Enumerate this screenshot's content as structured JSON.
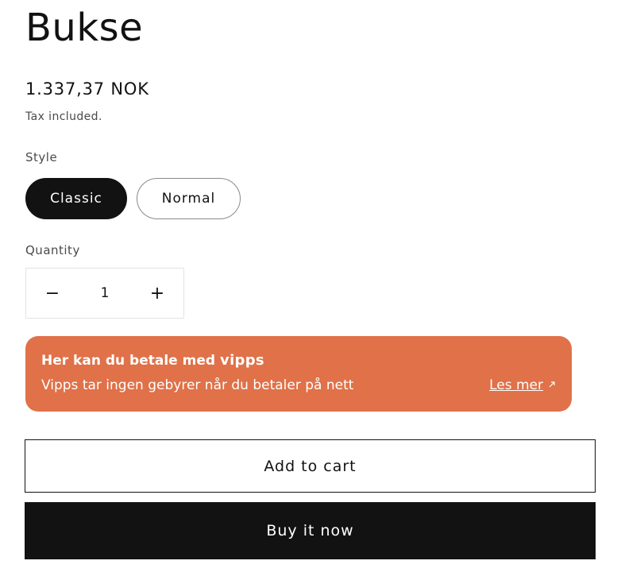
{
  "product": {
    "title": "Bukse",
    "price": "1.337,37 NOK",
    "tax_note": "Tax included."
  },
  "style": {
    "label": "Style",
    "options": [
      "Classic",
      "Normal"
    ],
    "selected": "Classic"
  },
  "quantity": {
    "label": "Quantity",
    "value": "1",
    "decrease_symbol": "−",
    "increase_symbol": "+"
  },
  "vipps_banner": {
    "heading": "Her kan du betale med",
    "logo_text": "vipps",
    "text": "Vipps tar ingen gebyrer når du betaler på nett",
    "link_label": "Les mer",
    "link_icon": "external-arrow-icon",
    "background_color": "#e07148"
  },
  "actions": {
    "add_to_cart": "Add to cart",
    "buy_now": "Buy it now"
  },
  "colors": {
    "primary": "#121212",
    "background": "#ffffff"
  }
}
